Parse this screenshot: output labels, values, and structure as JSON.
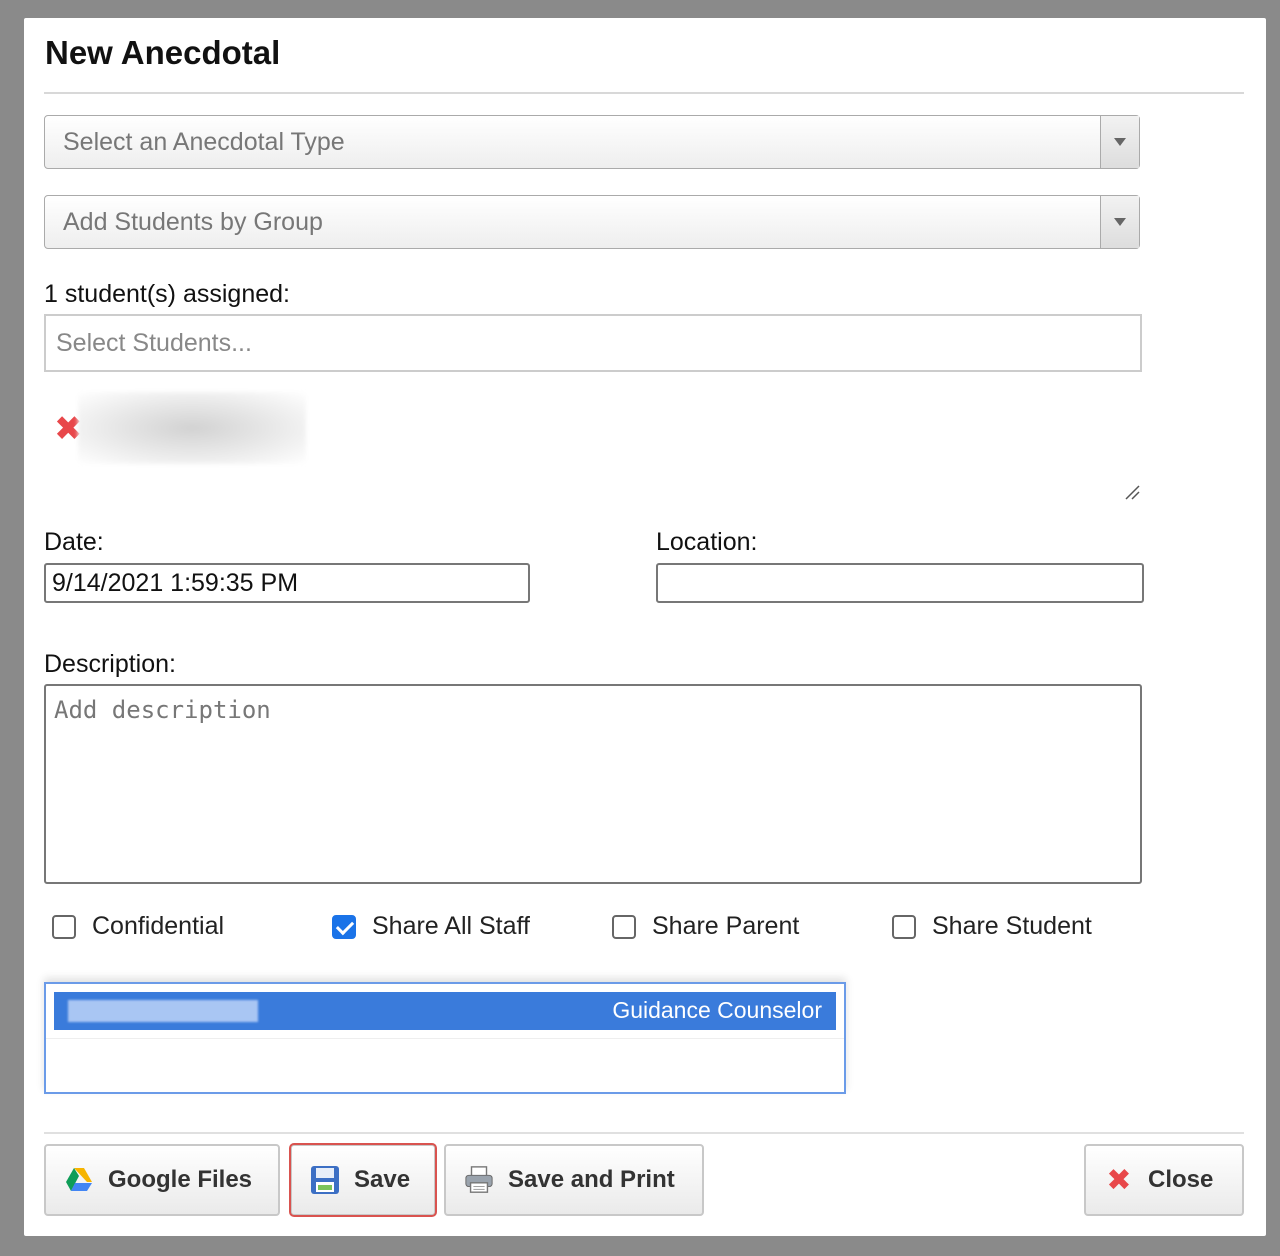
{
  "dialog": {
    "title": "New Anecdotal",
    "anecdotal_type": {
      "placeholder": "Select an Anecdotal Type"
    },
    "group_select": {
      "placeholder": "Add Students by Group"
    },
    "students_assigned_label": "1 student(s) assigned:",
    "students_input": {
      "placeholder": "Select Students..."
    },
    "date": {
      "label": "Date:",
      "value": "9/14/2021 1:59:35 PM"
    },
    "location": {
      "label": "Location:",
      "value": ""
    },
    "description": {
      "label": "Description:",
      "placeholder": "Add description"
    },
    "checkboxes": [
      {
        "label": "Confidential",
        "checked": false
      },
      {
        "label": "Share All Staff",
        "checked": true
      },
      {
        "label": "Share Parent",
        "checked": false
      },
      {
        "label": "Share Student",
        "checked": false
      }
    ],
    "staff_list": {
      "selected_role": "Guidance Counselor"
    },
    "buttons": {
      "google_files": "Google Files",
      "save": "Save",
      "save_and_print": "Save and Print",
      "close": "Close"
    }
  },
  "colors": {
    "accent_blue": "#3a7bdb",
    "close_red": "#e8474a",
    "save_highlight": "#d9534f"
  }
}
